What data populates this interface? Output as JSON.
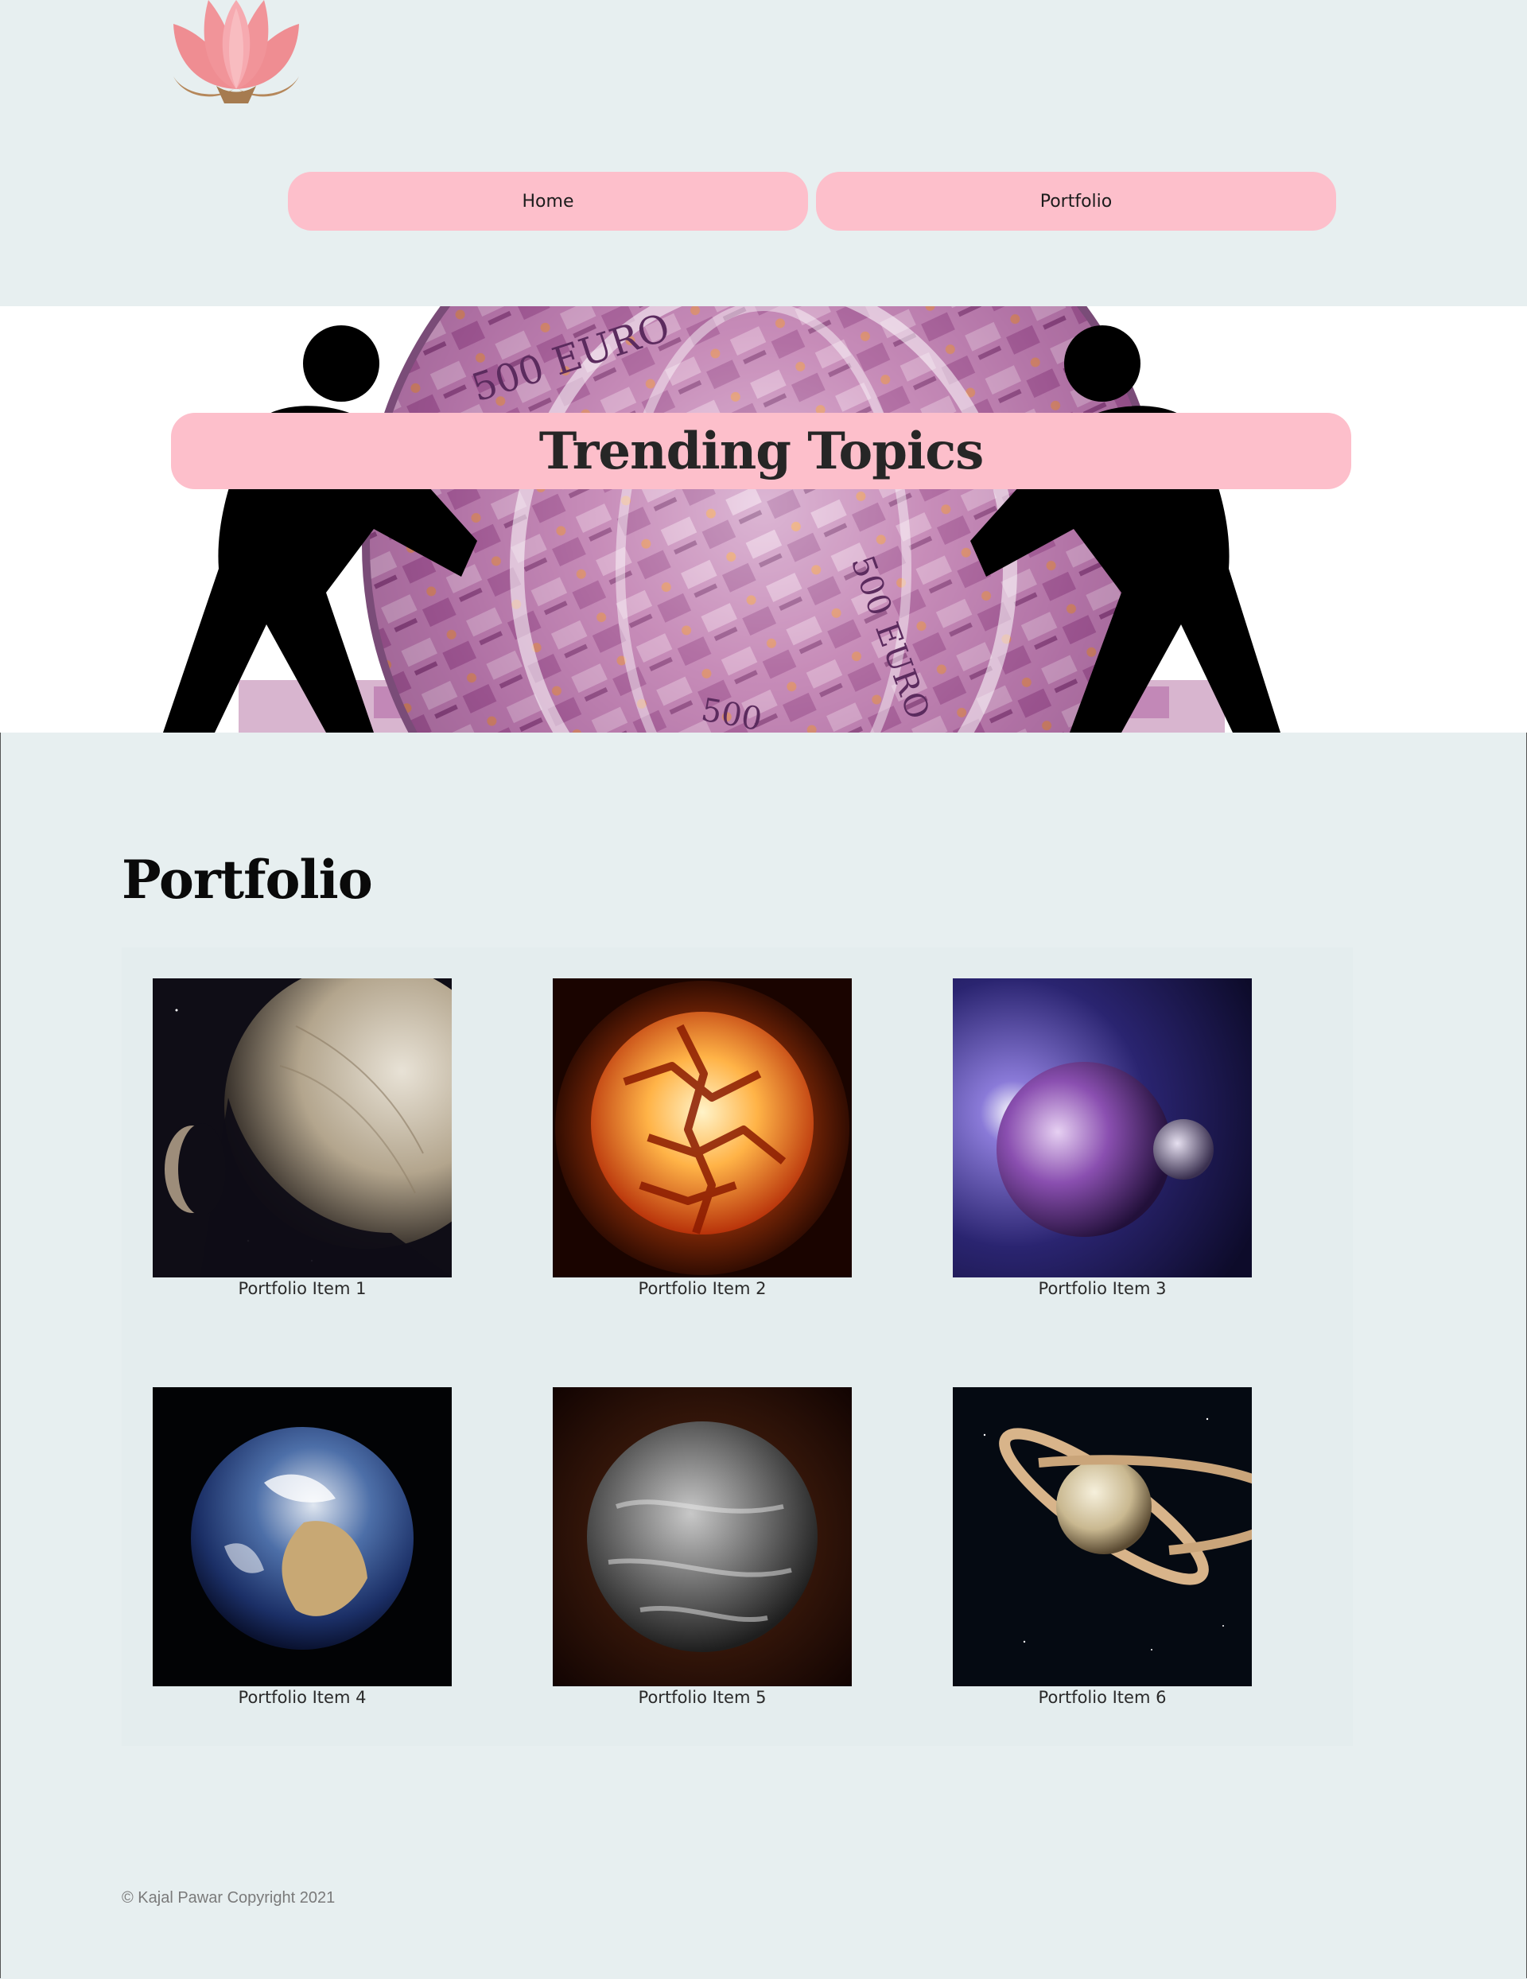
{
  "header": {
    "logo_icon": "lotus-icon",
    "nav": [
      {
        "label": "Home"
      },
      {
        "label": "Portfolio"
      }
    ]
  },
  "hero": {
    "title": "Trending Topics",
    "image_icon": "people-pushing-globe-of-money-image"
  },
  "portfolio": {
    "title": "Portfolio",
    "items": [
      {
        "caption": "Portfolio Item 1",
        "image": "moon-europa-image"
      },
      {
        "caption": "Portfolio Item 2",
        "image": "molten-planet-image"
      },
      {
        "caption": "Portfolio Item 3",
        "image": "purple-planet-with-moon-image"
      },
      {
        "caption": "Portfolio Item 4",
        "image": "earth-image"
      },
      {
        "caption": "Portfolio Item 5",
        "image": "grey-planet-image"
      },
      {
        "caption": "Portfolio Item 6",
        "image": "saturn-image"
      }
    ]
  },
  "footer": {
    "copyright": "© Kajal Pawar Copyright 2021"
  },
  "colors": {
    "background": "#e7eff0",
    "accent_pink": "#fdbfcb",
    "text_dark": "#0a0a0a"
  }
}
